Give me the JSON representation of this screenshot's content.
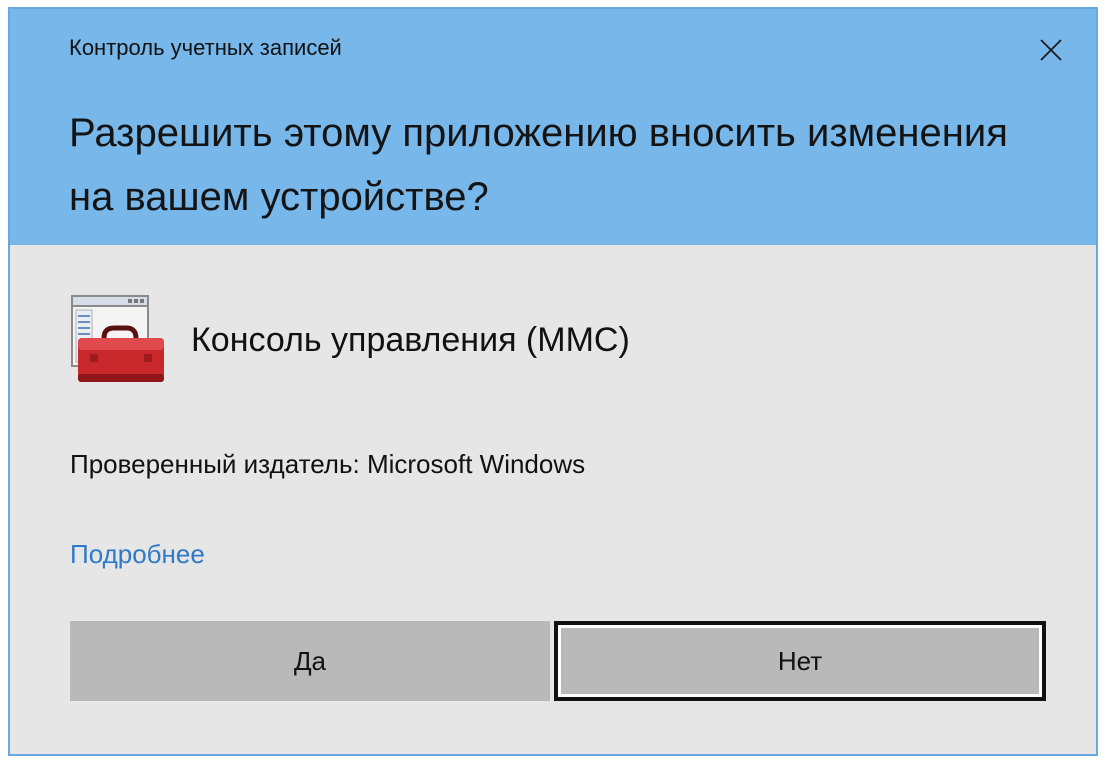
{
  "dialog": {
    "title": "Контроль учетных записей",
    "close_icon": "close-icon",
    "question": "Разрешить этому приложению вносить изменения на вашем устройстве?",
    "app": {
      "icon": "toolbox-window-icon",
      "name": "Консоль управления (MMC)"
    },
    "publisher": "Проверенный издатель: Microsoft Windows",
    "details_link": "Подробнее",
    "buttons": {
      "yes": "Да",
      "no": "Нет"
    },
    "colors": {
      "header": "#77b7ea",
      "body": "#e6e6e6",
      "link": "#2f7ac8",
      "button": "#b9b9b9"
    }
  }
}
